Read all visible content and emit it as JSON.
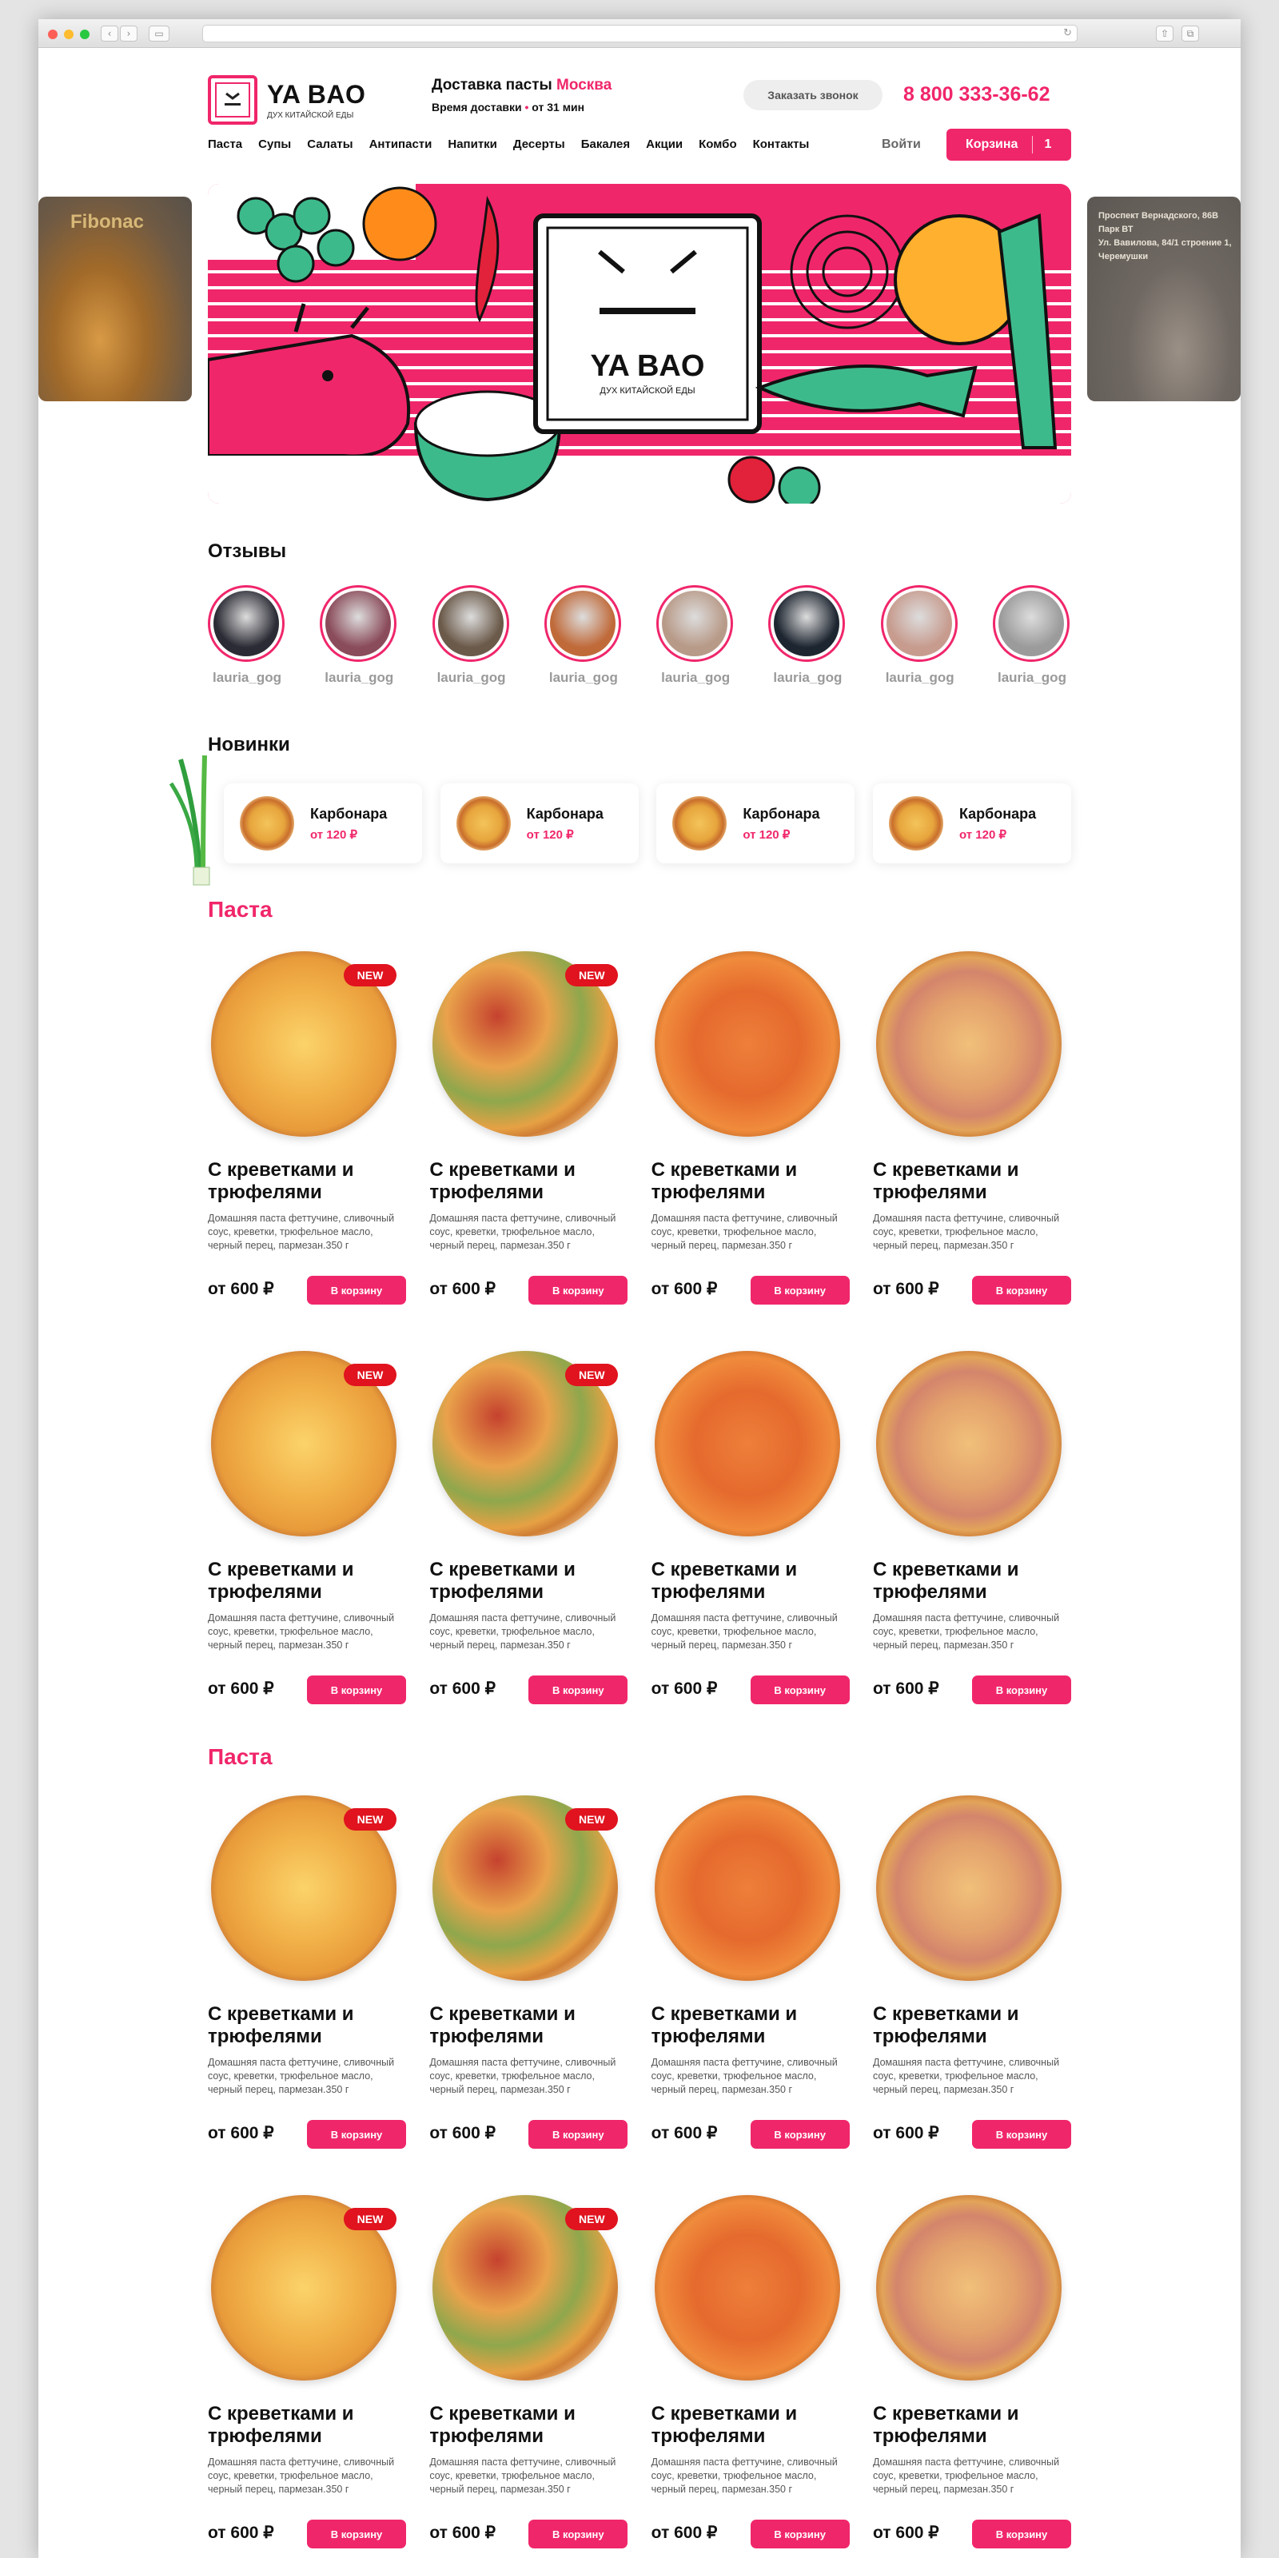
{
  "header": {
    "logo_name": "YA BAO",
    "logo_sub": "ДУХ КИТАЙСКОЙ ЕДЫ",
    "delivery_label": "Доставка пасты",
    "delivery_city": "Москва",
    "delivery_time_label": "Время доставки",
    "delivery_time_value": "от 31 мин",
    "call_button": "Заказать звонок",
    "phone": "8 800 333-36-62",
    "login": "Войти",
    "cart_label": "Корзина",
    "cart_count": "1"
  },
  "nav": [
    "Паста",
    "Супы",
    "Салаты",
    "Антипасти",
    "Напитки",
    "Десерты",
    "Бакалея",
    "Акции",
    "Комбо",
    "Контакты"
  ],
  "banner": {
    "logo_name": "YA BAO",
    "logo_sub": "ДУХ КИТАЙСКОЙ ЕДЫ",
    "left_text": "Fibonac",
    "right_text_1": "Проспект Вернадского, 86В Парк ВТ",
    "right_text_2": "Ул. Вавилова, 84/1 строение 1, Черемушки"
  },
  "reviews": {
    "title": "Отзывы",
    "items": [
      {
        "user": "lauria_gog",
        "tone": "#2b2b35"
      },
      {
        "user": "lauria_gog",
        "tone": "#8a4b5a"
      },
      {
        "user": "lauria_gog",
        "tone": "#6b5a4a"
      },
      {
        "user": "lauria_gog",
        "tone": "#c06a3a"
      },
      {
        "user": "lauria_gog",
        "tone": "#b89a88"
      },
      {
        "user": "lauria_gog",
        "tone": "#1d2530"
      },
      {
        "user": "lauria_gog",
        "tone": "#c79c8f"
      },
      {
        "user": "lauria_gog",
        "tone": "#9b9b9b"
      }
    ]
  },
  "novinki": {
    "title": "Новинки",
    "items": [
      {
        "name": "Карбонара",
        "price": "от 120 ₽"
      },
      {
        "name": "Карбонара",
        "price": "от 120 ₽"
      },
      {
        "name": "Карбонара",
        "price": "от 120 ₽"
      },
      {
        "name": "Карбонара",
        "price": "от 120 ₽"
      }
    ]
  },
  "products": {
    "section1_title": "Паста",
    "section2_title": "Паста",
    "name": "С креветками и трюфелями",
    "desc": "Домашняя паста феттучине, сливочный соус, креветки, трюфельное масло, черный перец, пармезан.350 г",
    "price": "от 600 ₽",
    "buy": "В корзину",
    "badge": "NEW",
    "row_pattern": [
      {
        "style": "cheese",
        "new": true
      },
      {
        "style": "mix",
        "new": true
      },
      {
        "style": "sauce",
        "new": false
      },
      {
        "style": "ham",
        "new": false
      }
    ]
  },
  "colors": {
    "accent": "#f0266b",
    "new_badge": "#e0131f"
  }
}
